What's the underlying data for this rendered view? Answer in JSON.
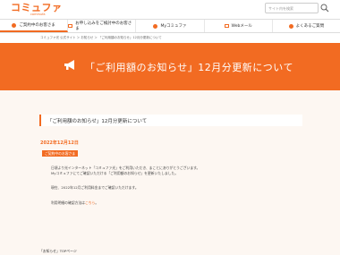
{
  "header": {
    "logo_main": "コミュファ",
    "logo_sub": "commufa",
    "search_placeholder": "サイト内を検索"
  },
  "nav": {
    "items": [
      {
        "label": "ご契約中のお客さま"
      },
      {
        "label": "お申し込みをご検討中のお客さま"
      },
      {
        "label": "Myコミュファ"
      },
      {
        "label": "Webメール"
      },
      {
        "label": "よくあるご質問"
      }
    ]
  },
  "breadcrumb": "コミュファ光 公式サイト ＞ お知らせ ＞ 「ご利用額のお知らせ」12月分更新について",
  "banner": {
    "title": "「ご利用額のお知らせ」12月分更新について"
  },
  "article": {
    "heading": "「ご利用額のお知らせ」12月分更新について",
    "date": "2022年12月12日",
    "label": "ご契約中のお客さま",
    "p1": "日頃より光インターネット「コミュファ光」をご利用いただき、まことにありがとうございます。",
    "p2": "Myコミュファにてご確認いただける「ご利用額のお知らせ」を更新いたしました。",
    "p3": "現在、2022年12月ご利用料金までご確認いただけます。",
    "p4_prefix": "利用明細の確認方法は",
    "p4_link": "こちら",
    "p4_suffix": "。"
  },
  "footer_link": "「お知らせ」TOPページ"
}
